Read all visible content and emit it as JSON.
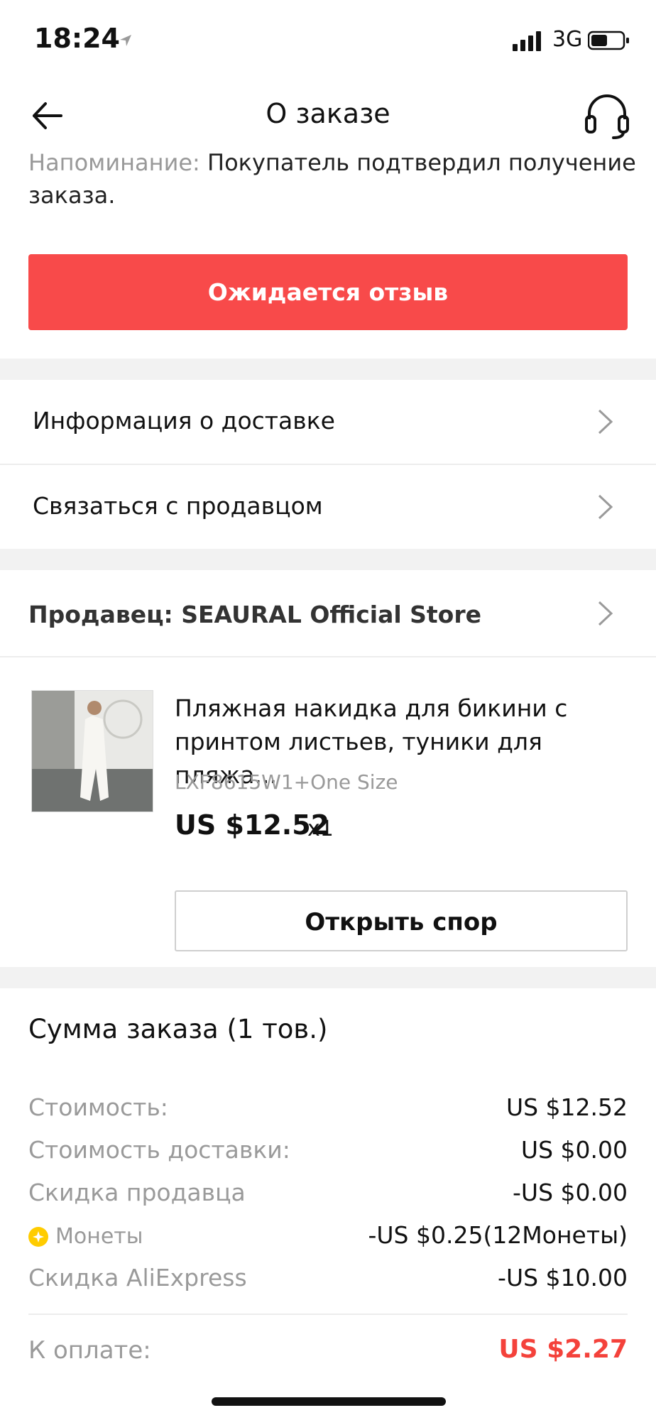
{
  "status_bar": {
    "time": "18:24",
    "network": "3G"
  },
  "header": {
    "title": "О заказе"
  },
  "reminder": {
    "label": "Напоминание:",
    "text": "Покупатель подтвердил получение заказа."
  },
  "status_button": {
    "label": "Ожидается отзыв",
    "color": "#f84a4a"
  },
  "menu": {
    "delivery_info": "Информация о доставке",
    "contact_seller": "Связаться с продавцом"
  },
  "seller": {
    "label": "Продавец: SEAURAL Official Store"
  },
  "product": {
    "title": "Пляжная накидка для бикини с принтом листьев, туники для пляжа...",
    "sku": "LXF8615W1+One Size",
    "price": "US $12.52",
    "qty": "x1",
    "dispute_button": "Открыть спор"
  },
  "summary": {
    "title": "Сумма заказа (1 тов.)",
    "rows": [
      {
        "label": "Стоимость:",
        "value": "US $12.52"
      },
      {
        "label": "Стоимость доставки:",
        "value": "US $0.00"
      },
      {
        "label": "Скидка продавца",
        "value": "-US $0.00"
      },
      {
        "label": "Монеты",
        "value": "-US $0.25(12Монеты)"
      },
      {
        "label": "Скидка AliExpress",
        "value": "-US $10.00"
      }
    ],
    "total_label": "К оплате:",
    "total_value": "US $2.27",
    "total_color": "#f4423b"
  }
}
